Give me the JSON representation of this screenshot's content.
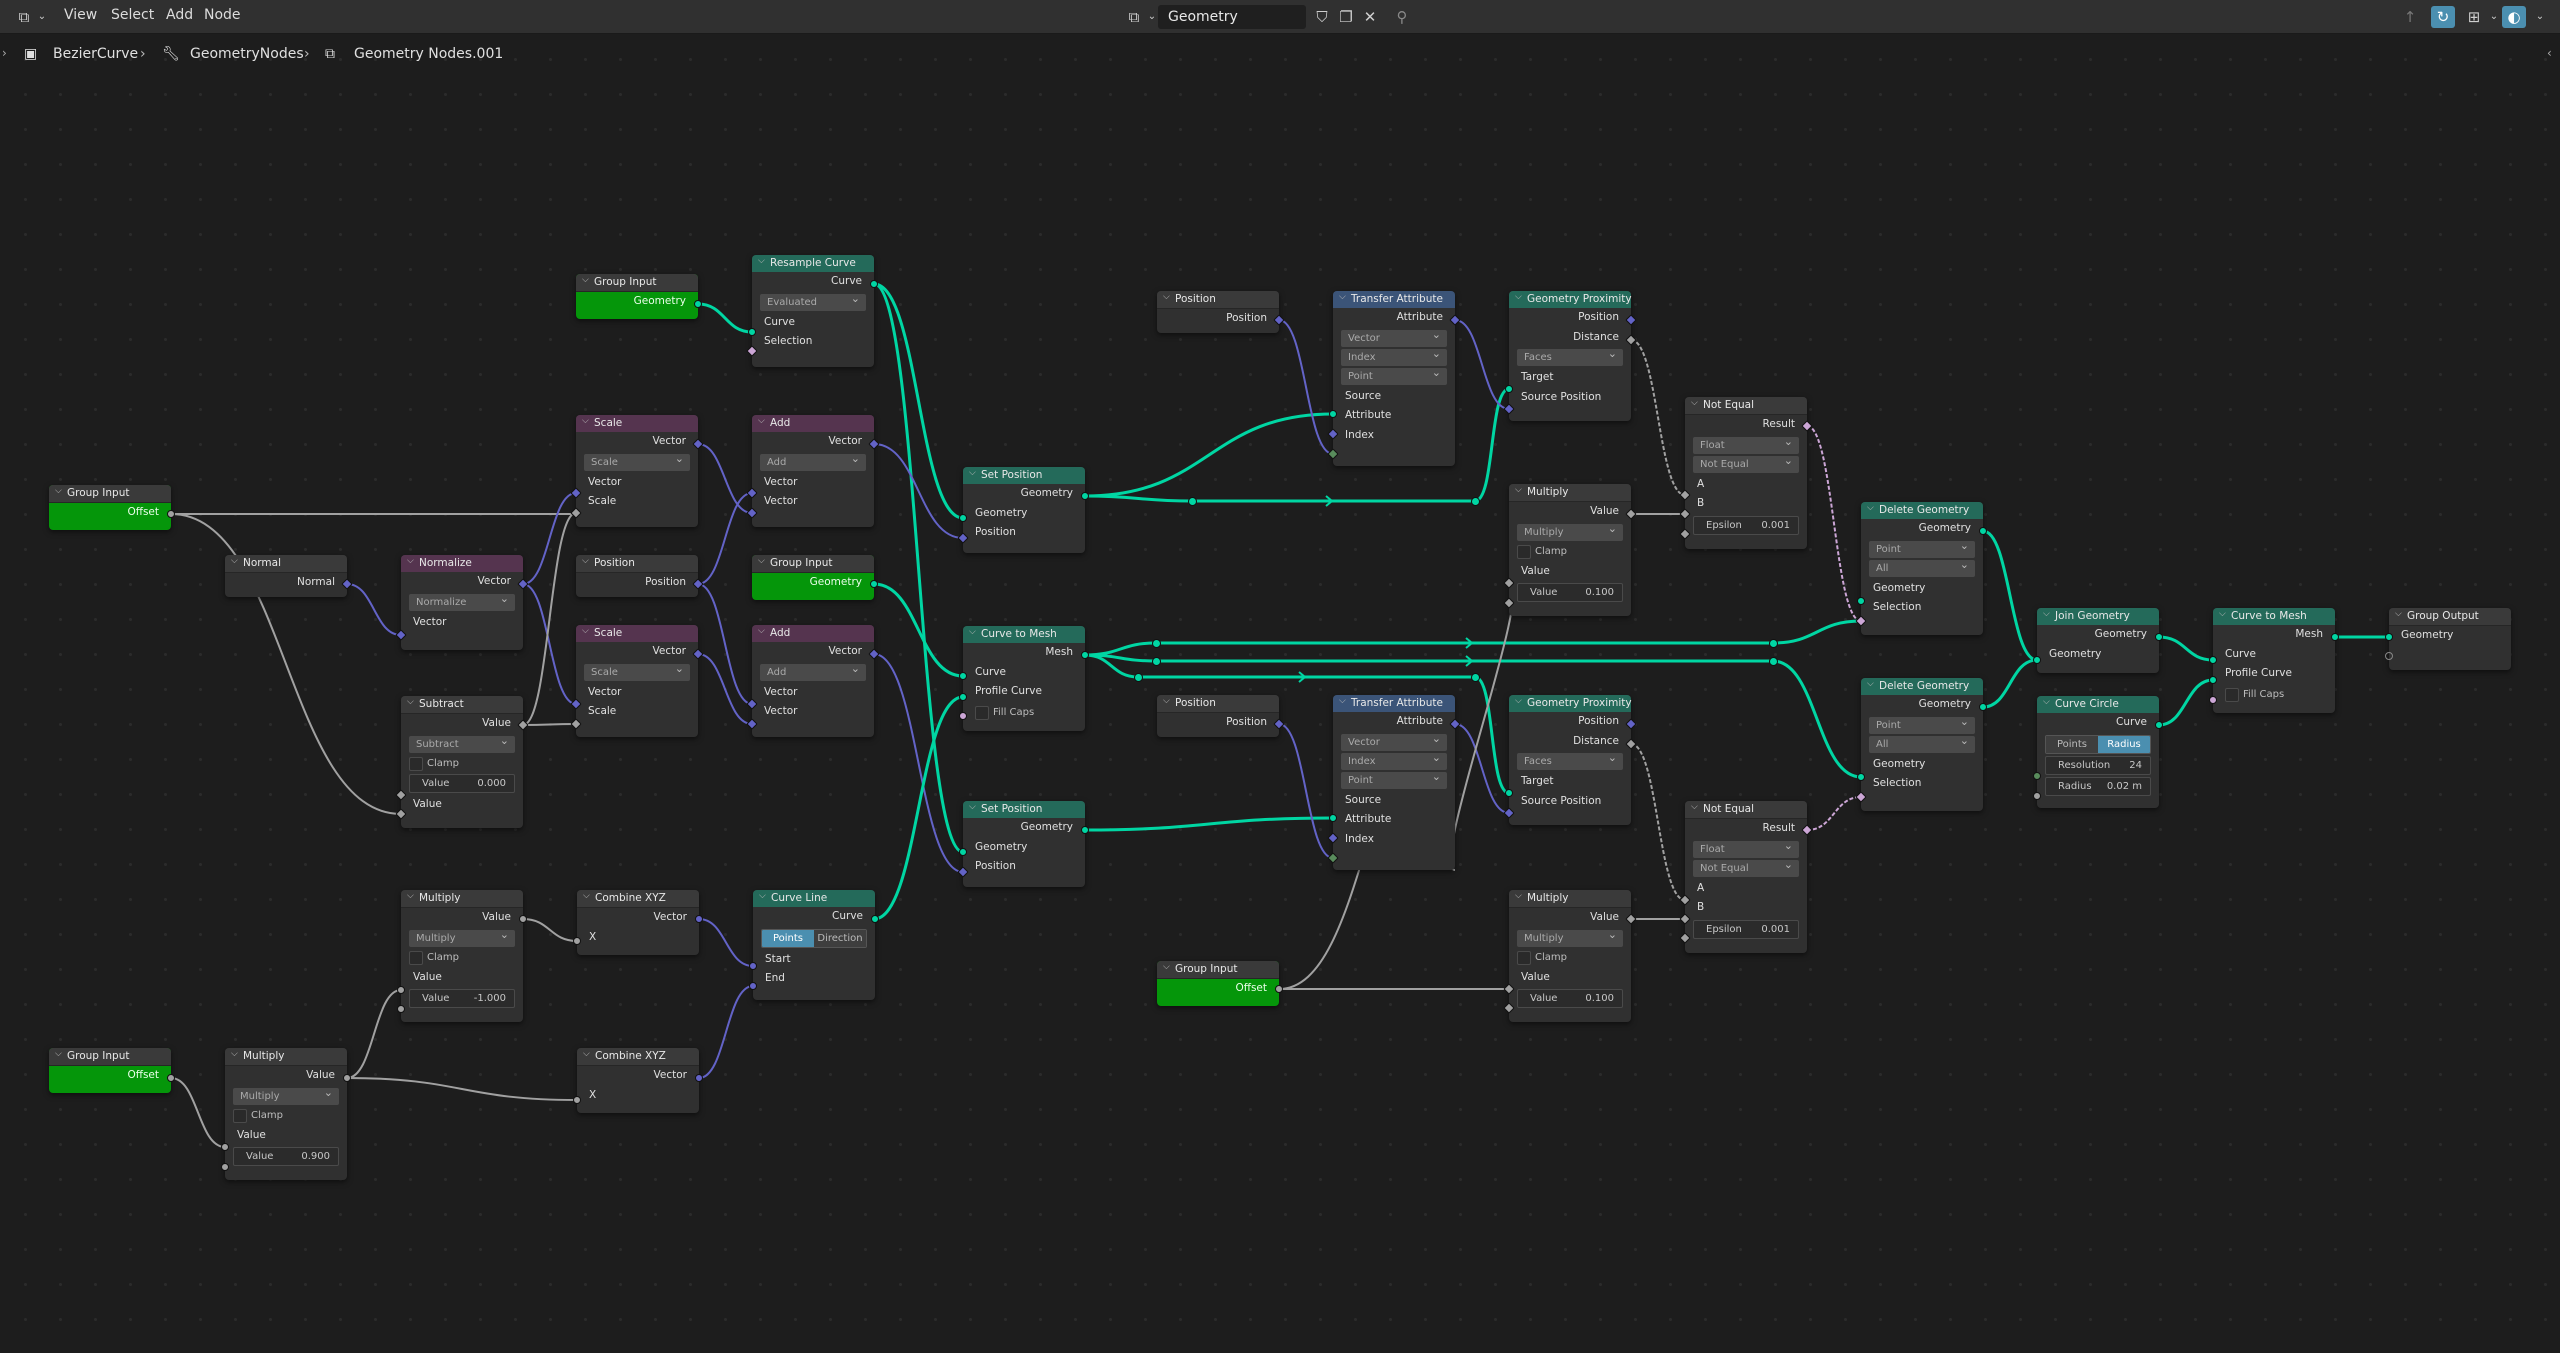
{
  "topbar": {
    "menus": [
      "View",
      "Select",
      "Add",
      "Node"
    ],
    "node_tree_name": "Geometry Nodes.001",
    "icons": [
      "editor-type-icon",
      "fake-user-shield-icon",
      "duplicate-icon",
      "unlink-close-icon",
      "pin-icon",
      "parent-up-icon",
      "snap-icon",
      "overlay-icon",
      "gizmo-icon"
    ]
  },
  "breadcrumb": {
    "object": "BezierCurve",
    "modifier": "GeometryNodes",
    "tree": "Geometry Nodes.001"
  },
  "nodes": {
    "gi_geo": {
      "title": "Group Input",
      "out": "Geometry"
    },
    "resample": {
      "title": "Resample Curve",
      "out": "Curve",
      "mode": "Evaluated",
      "in1": "Curve",
      "in2": "Selection"
    },
    "gi_offset1": {
      "title": "Group Input",
      "out": "Offset"
    },
    "normal": {
      "title": "Normal",
      "out": "Normal"
    },
    "normalize": {
      "title": "Normalize",
      "out": "Vector",
      "op": "Normalize",
      "in1": "Vector"
    },
    "scale1": {
      "title": "Scale",
      "out": "Vector",
      "op": "Scale",
      "in1": "Vector",
      "in2": "Scale"
    },
    "add1": {
      "title": "Add",
      "out": "Vector",
      "op": "Add",
      "in1": "Vector",
      "in2": "Vector"
    },
    "position1": {
      "title": "Position",
      "out": "Position"
    },
    "gi_geo2": {
      "title": "Group Input",
      "out": "Geometry"
    },
    "scale2": {
      "title": "Scale",
      "out": "Vector",
      "op": "Scale",
      "in1": "Vector",
      "in2": "Scale"
    },
    "add2": {
      "title": "Add",
      "out": "Vector",
      "op": "Add",
      "in1": "Vector",
      "in2": "Vector"
    },
    "subtract": {
      "title": "Subtract",
      "out": "Value",
      "op": "Subtract",
      "clamp": "Clamp",
      "in1": "Value",
      "field_label": "Value",
      "field_value": "0.000"
    },
    "multiply1": {
      "title": "Multiply",
      "out": "Value",
      "op": "Multiply",
      "clamp": "Clamp",
      "in1": "Value",
      "field_label": "Value",
      "field_value": "-1.000"
    },
    "combine1": {
      "title": "Combine XYZ",
      "out": "Vector",
      "in1": "X"
    },
    "curveline": {
      "title": "Curve Line",
      "out": "Curve",
      "seg_a": "Points",
      "seg_b": "Direction",
      "in1": "Start",
      "in2": "End"
    },
    "gi_offset2": {
      "title": "Group Input",
      "out": "Offset"
    },
    "multiply2": {
      "title": "Multiply",
      "out": "Value",
      "op": "Multiply",
      "clamp": "Clamp",
      "in1": "Value",
      "field_label": "Value",
      "field_value": "0.900"
    },
    "combine2": {
      "title": "Combine XYZ",
      "out": "Vector",
      "in1": "X"
    },
    "setpos1": {
      "title": "Set Position",
      "out": "Geometry",
      "in1": "Geometry",
      "in2": "Position"
    },
    "c2m1": {
      "title": "Curve to Mesh",
      "out": "Mesh",
      "in1": "Curve",
      "in2": "Profile Curve",
      "in3": "Fill Caps"
    },
    "setpos2": {
      "title": "Set Position",
      "out": "Geometry",
      "in1": "Geometry",
      "in2": "Position"
    },
    "position2": {
      "title": "Position",
      "out": "Position"
    },
    "transfer1": {
      "title": "Transfer Attribute",
      "out": "Attribute",
      "dd1": "Vector",
      "dd2": "Index",
      "dd3": "Point",
      "in1": "Source",
      "in2": "Attribute",
      "in3": "Index"
    },
    "prox1": {
      "title": "Geometry Proximity",
      "out1": "Position",
      "out2": "Distance",
      "dd": "Faces",
      "in1": "Target",
      "in2": "Source Position"
    },
    "multiply3": {
      "title": "Multiply",
      "out": "Value",
      "op": "Multiply",
      "clamp": "Clamp",
      "in1": "Value",
      "field_label": "Value",
      "field_value": "0.100"
    },
    "noteq1": {
      "title": "Not Equal",
      "out": "Result",
      "dd1": "Float",
      "dd2": "Not Equal",
      "in1": "A",
      "in2": "B",
      "field_label": "Epsilon",
      "field_value": "0.001"
    },
    "delete1": {
      "title": "Delete Geometry",
      "out": "Geometry",
      "dd1": "Point",
      "dd2": "All",
      "in1": "Geometry",
      "in2": "Selection"
    },
    "position3": {
      "title": "Position",
      "out": "Position"
    },
    "transfer2": {
      "title": "Transfer Attribute",
      "out": "Attribute",
      "dd1": "Vector",
      "dd2": "Index",
      "dd3": "Point",
      "in1": "Source",
      "in2": "Attribute",
      "in3": "Index"
    },
    "prox2": {
      "title": "Geometry Proximity",
      "out1": "Position",
      "out2": "Distance",
      "dd": "Faces",
      "in1": "Target",
      "in2": "Source Position"
    },
    "gi_offset3": {
      "title": "Group Input",
      "out": "Offset"
    },
    "multiply4": {
      "title": "Multiply",
      "out": "Value",
      "op": "Multiply",
      "clamp": "Clamp",
      "in1": "Value",
      "field_label": "Value",
      "field_value": "0.100"
    },
    "noteq2": {
      "title": "Not Equal",
      "out": "Result",
      "dd1": "Float",
      "dd2": "Not Equal",
      "in1": "A",
      "in2": "B",
      "field_label": "Epsilon",
      "field_value": "0.001"
    },
    "delete2": {
      "title": "Delete Geometry",
      "out": "Geometry",
      "dd1": "Point",
      "dd2": "All",
      "in1": "Geometry",
      "in2": "Selection"
    },
    "join": {
      "title": "Join Geometry",
      "out": "Geometry",
      "in1": "Geometry"
    },
    "circle": {
      "title": "Curve Circle",
      "out": "Curve",
      "seg_a": "Points",
      "seg_b": "Radius",
      "f1_label": "Resolution",
      "f1_value": "24",
      "f2_label": "Radius",
      "f2_value": "0.02 m"
    },
    "c2m2": {
      "title": "Curve to Mesh",
      "out": "Mesh",
      "in1": "Curve",
      "in2": "Profile Curve",
      "in3": "Fill Caps"
    },
    "output": {
      "title": "Group Output",
      "in1": "Geometry"
    }
  },
  "colors": {
    "geometry_socket": "#00d6a3",
    "vector_socket": "#6363c7",
    "float_socket": "#a1a1a1",
    "boolean_socket": "#cca6d6",
    "integer_socket": "#598c5c",
    "group_input_body": "#05960a",
    "geometry_header": "#246a5a",
    "vector_header": "#55344f",
    "attribute_header": "#3b5478",
    "active_toggle": "#4b8fb0"
  }
}
